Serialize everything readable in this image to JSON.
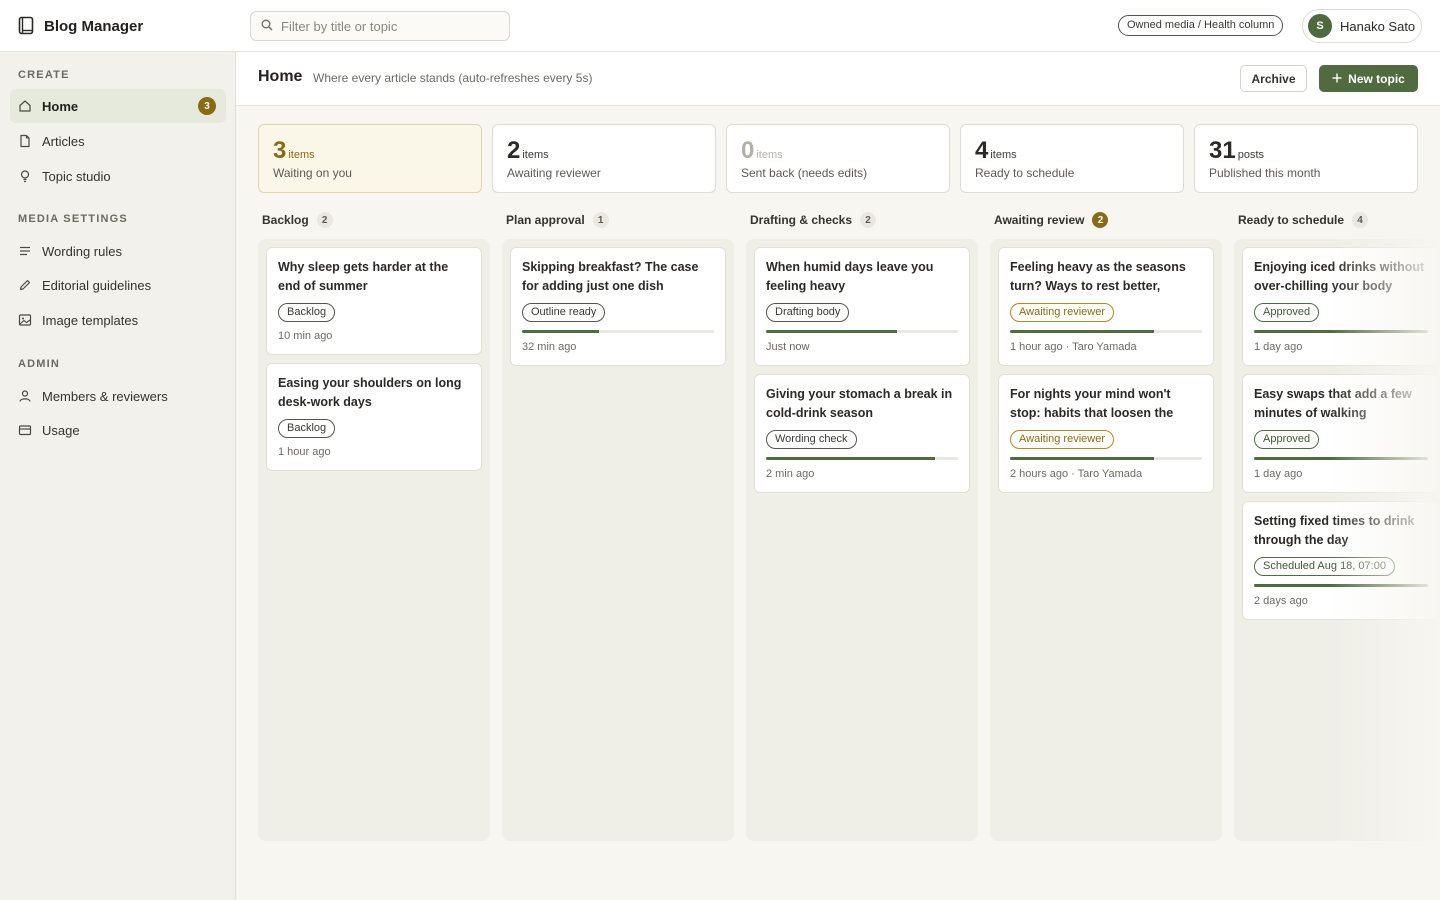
{
  "app": {
    "name": "Blog Manager"
  },
  "search": {
    "placeholder": "Filter by title or topic"
  },
  "context": {
    "label": "Owned media / Health column"
  },
  "user": {
    "initial": "S",
    "name": "Hanako Sato"
  },
  "sidebar": {
    "sections": [
      {
        "title": "CREATE",
        "items": [
          {
            "label": "Home",
            "icon": "home-icon",
            "badge": "3",
            "active": true
          },
          {
            "label": "Articles",
            "icon": "document-icon"
          },
          {
            "label": "Topic studio",
            "icon": "lightbulb-icon"
          }
        ]
      },
      {
        "title": "MEDIA SETTINGS",
        "items": [
          {
            "label": "Wording rules",
            "icon": "lines-icon"
          },
          {
            "label": "Editorial guidelines",
            "icon": "pencil-icon"
          },
          {
            "label": "Image templates",
            "icon": "image-icon"
          }
        ]
      },
      {
        "title": "ADMIN",
        "items": [
          {
            "label": "Members & reviewers",
            "icon": "user-icon"
          },
          {
            "label": "Usage",
            "icon": "card-icon"
          }
        ]
      }
    ]
  },
  "header": {
    "title": "Home",
    "subtitle": "Where every article stands (auto-refreshes every 5s)",
    "archive_label": "Archive",
    "new_topic_label": "New topic"
  },
  "stats": [
    {
      "value": "3",
      "unit": "items",
      "label": "Waiting on you"
    },
    {
      "value": "2",
      "unit": "items",
      "label": "Awaiting reviewer"
    },
    {
      "value": "0",
      "unit": "items",
      "label": "Sent back (needs edits)"
    },
    {
      "value": "4",
      "unit": "items",
      "label": "Ready to schedule"
    },
    {
      "value": "31",
      "unit": "posts",
      "label": "Published this month"
    }
  ],
  "columns": [
    {
      "title": "Backlog",
      "count": "2",
      "cards": [
        {
          "title": "Why sleep gets harder at the end of summer",
          "tag": "Backlog",
          "meta": "10 min ago"
        },
        {
          "title": "Easing your shoulders on long desk-work days",
          "tag": "Backlog",
          "meta": "1 hour ago"
        }
      ]
    },
    {
      "title": "Plan approval",
      "count": "1",
      "cards": [
        {
          "title": "Skipping breakfast? The case for adding just one dish",
          "tag": "Outline ready",
          "progress": 0.4,
          "meta": "32 min ago"
        }
      ]
    },
    {
      "title": "Drafting & checks",
      "count": "2",
      "cards": [
        {
          "title": "When humid days leave you feeling heavy",
          "tag": "Drafting body",
          "progress": 0.68,
          "meta": "Just now"
        },
        {
          "title": "Giving your stomach a break in cold-drink season",
          "tag": "Wording check",
          "progress": 0.88,
          "meta": "2 min ago"
        }
      ]
    },
    {
      "title": "Awaiting review",
      "count": "2",
      "cards": [
        {
          "title": "Feeling heavy as the seasons turn? Ways to rest better, starti...",
          "tag": "Awaiting reviewer",
          "progress": 0.75,
          "meta": "1 hour ago · Taro Yamada"
        },
        {
          "title": "For nights your mind won't stop: habits that loosen the tension",
          "tag": "Awaiting reviewer",
          "progress": 0.75,
          "meta": "2 hours ago · Taro Yamada"
        }
      ]
    },
    {
      "title": "Ready to schedule",
      "count": "4",
      "cards": [
        {
          "title": "Enjoying iced drinks without over-chilling your body",
          "tag": "Approved",
          "progress": 1,
          "meta": "1 day ago"
        },
        {
          "title": "Easy swaps that add a few minutes of walking",
          "tag": "Approved",
          "progress": 1,
          "meta": "1 day ago"
        },
        {
          "title": "Setting fixed times to drink through the day",
          "tag": "Scheduled Aug 18, 07:00",
          "progress": 1,
          "meta": "2 days ago"
        }
      ]
    }
  ]
}
